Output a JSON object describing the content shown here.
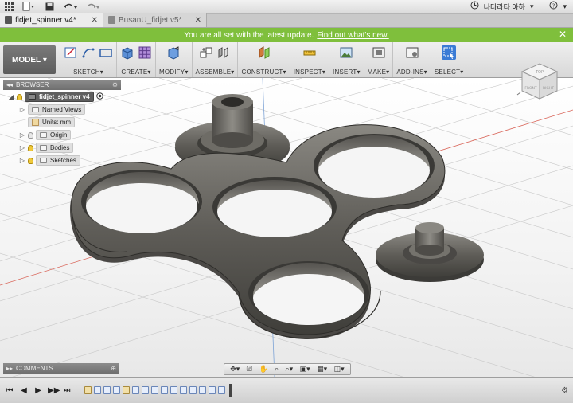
{
  "topbar": {
    "user_name": "나다라타 아하",
    "dropdown": "▾"
  },
  "tabs": [
    {
      "label": "fidjet_spinner v4*",
      "active": true
    },
    {
      "label": "BusanU_fidjet v5*",
      "active": false
    }
  ],
  "banner": {
    "message": "You are all set with the latest update.",
    "link": "Find out what's new."
  },
  "toolbar": {
    "model_label": "MODEL",
    "groups": [
      {
        "label": "SKETCH"
      },
      {
        "label": "CREATE"
      },
      {
        "label": "MODIFY"
      },
      {
        "label": "ASSEMBLE"
      },
      {
        "label": "CONSTRUCT"
      },
      {
        "label": "INSPECT"
      },
      {
        "label": "INSERT"
      },
      {
        "label": "MAKE"
      },
      {
        "label": "ADD-INS"
      },
      {
        "label": "SELECT"
      }
    ]
  },
  "browser": {
    "title": "BROWSER",
    "root": "fidjet_spinner v4",
    "items": [
      {
        "label": "Named Views"
      },
      {
        "label": "Units: mm"
      },
      {
        "label": "Origin"
      },
      {
        "label": "Bodies"
      },
      {
        "label": "Sketches"
      }
    ]
  },
  "comments": {
    "title": "COMMENTS"
  },
  "viewcube": {
    "top": "TOP",
    "front": "FRONT",
    "right": "RIGHT"
  },
  "colors": {
    "banner": "#7fbf3c",
    "model_body": "#6a6862",
    "select_accent": "#3a7bd5"
  }
}
